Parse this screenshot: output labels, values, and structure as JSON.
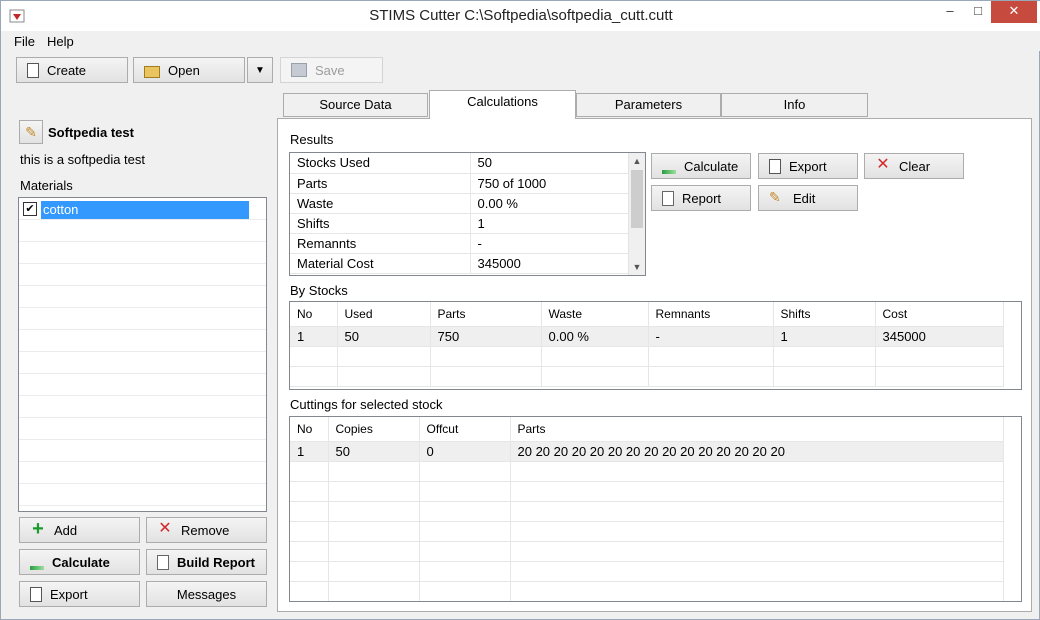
{
  "window": {
    "title": "STIMS Cutter  C:\\Softpedia\\softpedia_cutt.cutt",
    "min_symbol": "–",
    "max_symbol": "□",
    "close_symbol": "✕"
  },
  "menu": {
    "file": "File",
    "help": "Help"
  },
  "toolbar": {
    "create": "Create",
    "open": "Open",
    "dropdown_symbol": "▼",
    "save": "Save"
  },
  "project": {
    "name": "Softpedia test",
    "description": "this is a softpedia test",
    "materials_label": "Materials",
    "materials": [
      {
        "name": "cotton",
        "checked": true
      }
    ]
  },
  "left_buttons": {
    "add": "Add",
    "remove": "Remove",
    "calculate": "Calculate",
    "build_report": "Build Report",
    "export": "Export",
    "messages": "Messages"
  },
  "tabs": [
    {
      "label": "Source Data",
      "active": false
    },
    {
      "label": "Calculations",
      "active": true
    },
    {
      "label": "Parameters",
      "active": false
    },
    {
      "label": "Info",
      "active": false
    }
  ],
  "results": {
    "label": "Results",
    "rows": [
      {
        "key": "Stocks Used",
        "value": "50"
      },
      {
        "key": "Parts",
        "value": "750 of 1000"
      },
      {
        "key": "Waste",
        "value": "0.00 %"
      },
      {
        "key": "Shifts",
        "value": "1"
      },
      {
        "key": "Remannts",
        "value": "-"
      },
      {
        "key": "Material Cost",
        "value": "345000"
      }
    ]
  },
  "action_buttons": {
    "calculate": "Calculate",
    "export": "Export",
    "clear": "Clear",
    "report": "Report",
    "edit": "Edit"
  },
  "by_stocks": {
    "label": "By Stocks",
    "columns": [
      "No",
      "Used",
      "Parts",
      "Waste",
      "Remnants",
      "Shifts",
      "Cost"
    ],
    "rows": [
      [
        "1",
        "50",
        "750",
        "0.00 %",
        "-",
        "1",
        "345000"
      ]
    ]
  },
  "cuttings": {
    "label": "Cuttings for selected stock",
    "columns": [
      "No",
      "Copies",
      "Offcut",
      "Parts"
    ],
    "rows": [
      [
        "1",
        "50",
        "0",
        "20 20 20 20 20 20 20 20 20 20 20 20 20 20 20"
      ]
    ]
  },
  "colors": {
    "selection": "#3399ff",
    "close_button": "#c74a3e",
    "accent_green": "#2a9d3f"
  }
}
